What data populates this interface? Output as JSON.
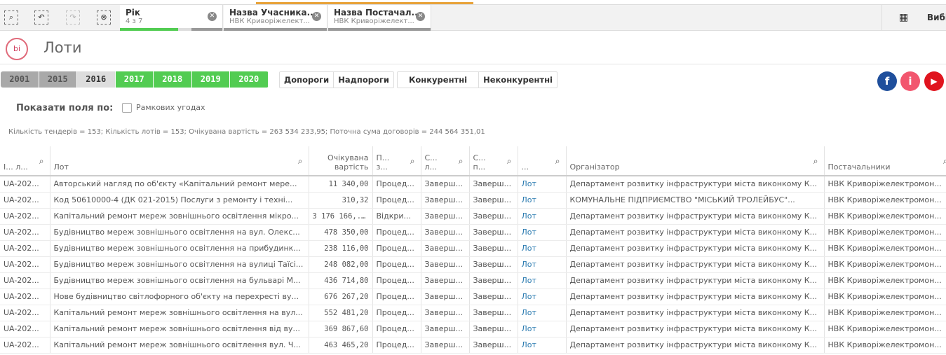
{
  "toolbar": {
    "tabs": [
      {
        "title": "Рік",
        "sub": "4 з 7"
      },
      {
        "title": "Назва Учасника...",
        "sub": "НВК Криворіжелект..."
      },
      {
        "title": "Назва Постачал...",
        "sub": "НВК Криворіжелект..."
      }
    ],
    "selections_label": "Вибірки"
  },
  "page": {
    "title": "Лоти",
    "logo": "bi"
  },
  "years": [
    {
      "label": "2001",
      "state": "excluded"
    },
    {
      "label": "2015",
      "state": "excluded"
    },
    {
      "label": "2016",
      "state": "alternative"
    },
    {
      "label": "2017",
      "state": "selected"
    },
    {
      "label": "2018",
      "state": "selected"
    },
    {
      "label": "2019",
      "state": "selected"
    },
    {
      "label": "2020",
      "state": "selected"
    }
  ],
  "threshold_buttons": [
    "Допороги",
    "Надпороги"
  ],
  "competition_buttons": [
    "Конкурентні",
    "Неконкурентні"
  ],
  "show_fields": {
    "label": "Показати поля по:",
    "checkbox_label": "Рамкових угодах",
    "checked": false
  },
  "stats": "Кількість тендерів = 153; Кількість лотів = 153; Очікувана вартість = 263 534 233,95; Поточна сума договорів = 244 564 351,01",
  "table": {
    "headers": [
      "І... л...",
      "Лот",
      "Очікувана вартість",
      "П... з...",
      "С... л...",
      "С... п...",
      "...",
      "Організатор",
      "Постачальники"
    ],
    "rows": [
      [
        "UA-202...",
        "Авторський нагляд по об'єкту «Капітальний ремонт мере...",
        "11 340,00",
        "Процед...",
        "Заверш...",
        "Заверш...",
        "Лот",
        "Департамент розвитку інфраструктури міста виконкому К...",
        "НВК Криворіжелектромон..."
      ],
      [
        "UA-202...",
        "Код 50610000-4 (ДК 021-2015) Послуги з ремонту і техні...",
        "310,32",
        "Процед...",
        "Заверш...",
        "Заверш...",
        "Лот",
        "КОМУНАЛЬНЕ ПІДПРИЄМСТВО \"МІСЬКИЙ ТРОЛЕЙБУС\"...",
        "НВК Криворіжелектромон..."
      ],
      [
        "UA-202...",
        "Капітальний ремонт мереж зовнішнього освітлення мікро...",
        "3 176 166,...",
        "Відкри...",
        "Заверш...",
        "Заверш...",
        "Лот",
        "Департамент розвитку інфраструктури міста виконкому К...",
        "НВК Криворіжелектромон..."
      ],
      [
        "UA-202...",
        "Будівництво мереж зовнішнього освітлення на вул. Олекс...",
        "478 350,00",
        "Процед...",
        "Заверш...",
        "Заверш...",
        "Лот",
        "Департамент розвитку інфраструктури міста виконкому К...",
        "НВК Криворіжелектромон..."
      ],
      [
        "UA-202...",
        "Будівництво мереж зовнішнього освітлення на прибудинк...",
        "238 116,00",
        "Процед...",
        "Заверш...",
        "Заверш...",
        "Лот",
        "Департамент розвитку інфраструктури міста виконкому К...",
        "НВК Криворіжелектромон..."
      ],
      [
        "UA-202...",
        "Будівництво мереж зовнішнього освітлення на вулиці Таїсі...",
        "248 082,00",
        "Процед...",
        "Заверш...",
        "Заверш...",
        "Лот",
        "Департамент розвитку інфраструктури міста виконкому К...",
        "НВК Криворіжелектромон..."
      ],
      [
        "UA-202...",
        "Будівництво мереж зовнішнього освітлення на бульварі М...",
        "436 714,80",
        "Процед...",
        "Заверш...",
        "Заверш...",
        "Лот",
        "Департамент розвитку інфраструктури міста виконкому К...",
        "НВК Криворіжелектромон..."
      ],
      [
        "UA-202...",
        "Нове будівництво світлофорного об'єкту на перехресті ву...",
        "676 267,20",
        "Процед...",
        "Заверш...",
        "Заверш...",
        "Лот",
        "Департамент розвитку інфраструктури міста виконкому К...",
        "НВК Криворіжелектромон..."
      ],
      [
        "UA-202...",
        "Капітальний ремонт мереж зовнішнього освітлення на вул...",
        "552 481,20",
        "Процед...",
        "Заверш...",
        "Заверш...",
        "Лот",
        "Департамент розвитку інфраструктури міста виконкому К...",
        "НВК Криворіжелектромон..."
      ],
      [
        "UA-202...",
        "Капітальний ремонт мереж зовнішнього освітлення від ву...",
        "369 867,60",
        "Процед...",
        "Заверш...",
        "Заверш...",
        "Лот",
        "Департамент розвитку інфраструктури міста виконкому К...",
        "НВК Криворіжелектромон..."
      ],
      [
        "UA-202...",
        "Капітальний ремонт мереж зовнішнього освітлення вул. Ч...",
        "463 465,20",
        "Процед...",
        "Заверш...",
        "Заверш...",
        "Лот",
        "Департамент розвитку інфраструктури міста виконкому К...",
        "НВК Криворіжелектромон..."
      ]
    ]
  },
  "colors": {
    "selected": "#52cc52",
    "excluded": "#a9a9a9",
    "alternative": "#dddddd",
    "facebook": "#1f4f9c",
    "info": "#f2566e",
    "youtube": "#e0141e",
    "link": "#2a7ab0"
  }
}
